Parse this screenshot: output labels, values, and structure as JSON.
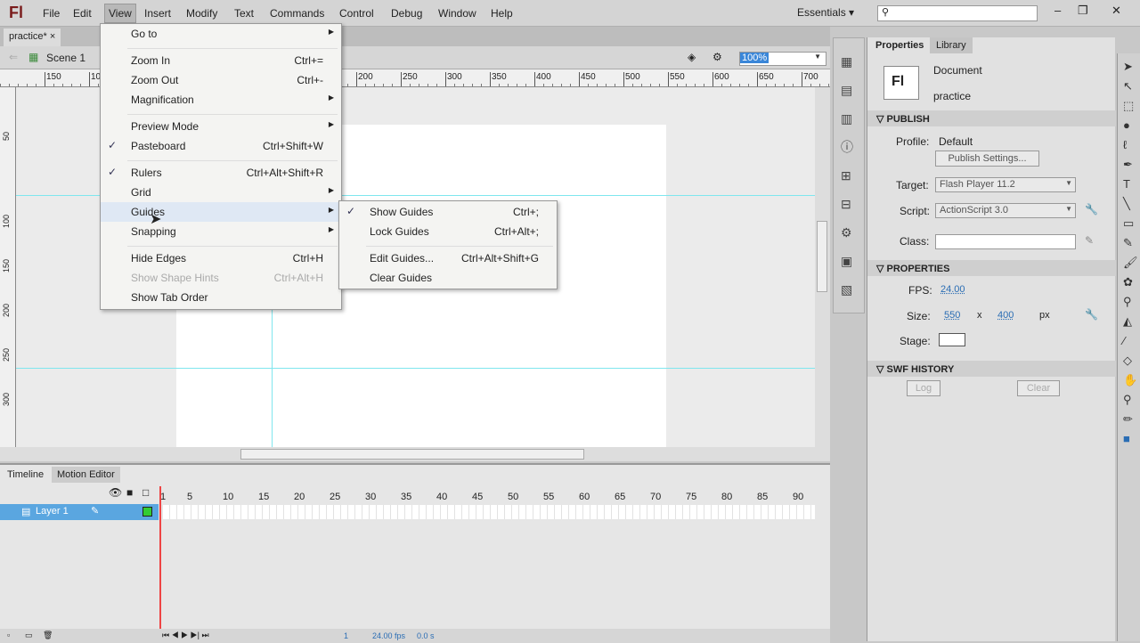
{
  "app": {
    "logo": "Fl"
  },
  "menubar": [
    "File",
    "Edit",
    "View",
    "Insert",
    "Modify",
    "Text",
    "Commands",
    "Control",
    "Debug",
    "Window",
    "Help"
  ],
  "workspace": "Essentials",
  "window_controls": [
    "–",
    "❐",
    "✕"
  ],
  "doc_tab": {
    "label": "practice*",
    "close": "×"
  },
  "editbar": {
    "scene": "Scene 1",
    "zoom": "100%"
  },
  "ruler_h": [
    "150",
    "10",
    "200",
    "250",
    "300",
    "350",
    "400",
    "450",
    "500",
    "550",
    "600",
    "650",
    "700"
  ],
  "ruler_v": [
    "50",
    "100",
    "150",
    "200",
    "250",
    "300"
  ],
  "view_menu": [
    {
      "label": "Go to",
      "submenu": true
    },
    {
      "label": "Zoom In",
      "shortcut": "Ctrl+="
    },
    {
      "label": "Zoom Out",
      "shortcut": "Ctrl+-"
    },
    {
      "label": "Magnification",
      "submenu": true
    },
    {
      "label": "Preview Mode",
      "submenu": true
    },
    {
      "label": "Pasteboard",
      "shortcut": "Ctrl+Shift+W",
      "checked": true
    },
    {
      "label": "Rulers",
      "shortcut": "Ctrl+Alt+Shift+R",
      "checked": true
    },
    {
      "label": "Grid",
      "submenu": true
    },
    {
      "label": "Guides",
      "submenu": true
    },
    {
      "label": "Snapping",
      "submenu": true
    },
    {
      "label": "Hide Edges",
      "shortcut": "Ctrl+H"
    },
    {
      "label": "Show Shape Hints",
      "shortcut": "Ctrl+Alt+H",
      "disabled": true
    },
    {
      "label": "Show Tab Order"
    }
  ],
  "guides_submenu": [
    {
      "label": "Show Guides",
      "shortcut": "Ctrl+;",
      "checked": true
    },
    {
      "label": "Lock Guides",
      "shortcut": "Ctrl+Alt+;"
    },
    {
      "label": "Edit Guides...",
      "shortcut": "Ctrl+Alt+Shift+G"
    },
    {
      "label": "Clear Guides"
    }
  ],
  "check": "✓",
  "timeline": {
    "tabs": [
      "Timeline",
      "Motion Editor"
    ],
    "layer": "Layer 1",
    "frames": [
      "1",
      "5",
      "10",
      "15",
      "20",
      "25",
      "30",
      "35",
      "40",
      "45",
      "50",
      "55",
      "60",
      "65",
      "70",
      "75",
      "80",
      "85",
      "90"
    ],
    "current_frame": "1",
    "fps": "24.00 fps",
    "time": "0.0 s"
  },
  "properties": {
    "tabs": [
      "Properties",
      "Library"
    ],
    "doc_type": "Document",
    "doc_name": "practice",
    "publish": {
      "header": "PUBLISH",
      "profile_label": "Profile:",
      "profile": "Default",
      "settings_btn": "Publish Settings...",
      "target_label": "Target:",
      "target": "Flash Player 11.2",
      "script_label": "Script:",
      "script": "ActionScript 3.0",
      "class_label": "Class:"
    },
    "props": {
      "header": "PROPERTIES",
      "fps_label": "FPS:",
      "fps": "24.00",
      "size_label": "Size:",
      "width": "550",
      "x": "x",
      "height": "400",
      "unit": "px",
      "stage_label": "Stage:"
    },
    "swf": {
      "header": "SWF HISTORY",
      "log": "Log",
      "clear": "Clear"
    }
  }
}
